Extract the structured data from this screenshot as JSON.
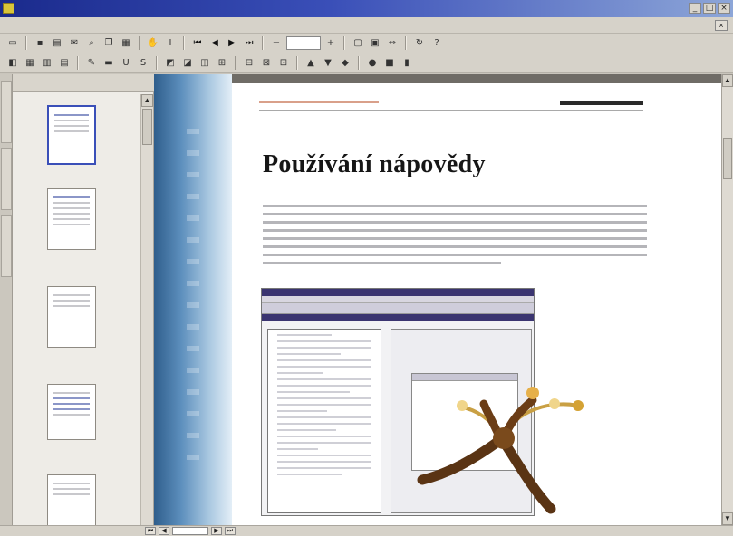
{
  "window": {
    "title": "",
    "minimize_glyph": "_",
    "maximize_glyph": "□",
    "close_glyph": "×"
  },
  "menubar": {
    "items": [
      "",
      "",
      "",
      "",
      "",
      ""
    ],
    "doc_close_glyph": "×"
  },
  "toolbar": {
    "zoom_value": ""
  },
  "left_tabs": {
    "items": [
      "",
      "",
      ""
    ]
  },
  "thumbnails": {
    "options_label": "",
    "pages": [
      {
        "label": ""
      },
      {
        "label": ""
      },
      {
        "label": ""
      },
      {
        "label": ""
      },
      {
        "label": ""
      }
    ]
  },
  "document": {
    "breadcrumb": "",
    "page_nav": "",
    "heading": "Používání nápovědy",
    "subheading": ""
  },
  "statusbar": {
    "page_value": ""
  },
  "colors": {
    "titlebar_start": "#1a2a8c",
    "titlebar_end": "#8da6d8",
    "page_link": "#2b3b9a",
    "strip_blue": "#2f5e8c"
  }
}
